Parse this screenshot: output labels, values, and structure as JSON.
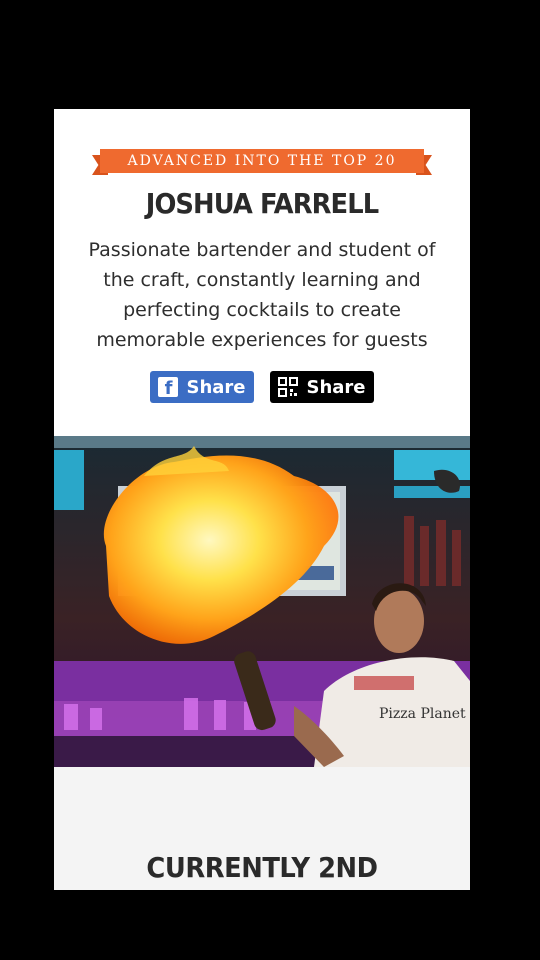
{
  "contestant": {
    "ribbon_text": "ADVANCED INTO THE TOP 20",
    "name": "JOSHUA FARRELL",
    "bio": "Passionate bartender and student of the craft, constantly learning and perfecting cocktails to create memorable experiences for guests"
  },
  "share": {
    "facebook_label": "Share",
    "qr_label": "Share"
  },
  "photo": {
    "shirt_text": "Pizza Planet"
  },
  "standing": {
    "text": "CURRENTLY 2ND"
  },
  "colors": {
    "ribbon": "#ef6a2f",
    "facebook_blue": "#3b6dc4"
  }
}
